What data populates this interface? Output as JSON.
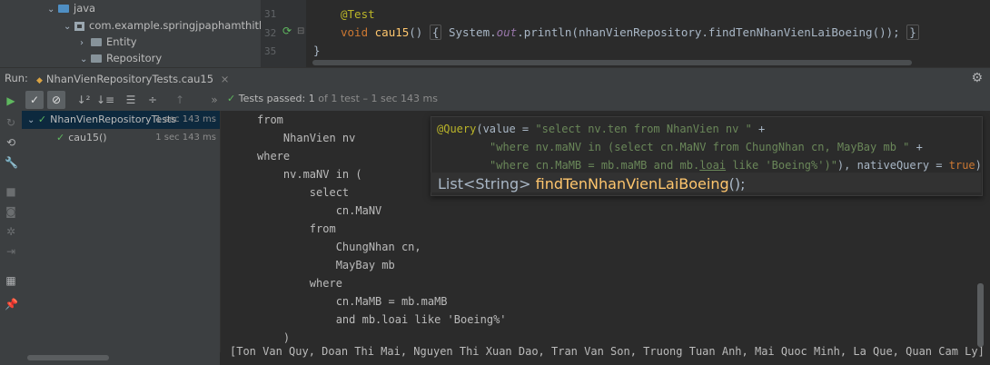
{
  "project_tree": {
    "items": [
      {
        "label": "java",
        "icon": "folder-blue-icon"
      },
      {
        "label": "com.example.springjpaphamthithanhn",
        "icon": "package-icon"
      },
      {
        "label": "Entity",
        "icon": "folder-icon"
      },
      {
        "label": "Repository",
        "icon": "folder-icon"
      }
    ]
  },
  "editor": {
    "line_numbers": [
      "31",
      "32",
      "35"
    ],
    "annotation": "@Test",
    "kw_void": "void",
    "method_name": "cau15",
    "parens": "()",
    "body_open": "{",
    "system": "System.",
    "out": "out",
    "println": ".println(",
    "repo_call": "nhanVienRepository",
    "find_method": ".findTenNhanVienLaiBoeing",
    "call_end": "());",
    "body_close": "}",
    "closing_brace": "}"
  },
  "run_bar": {
    "run_label": "Run:",
    "tab_label": "NhanVienRepositoryTests.cau15",
    "tab_close": "×"
  },
  "test_toolbar": {
    "tests_passed": "Tests passed:",
    "tests_count": "1",
    "tests_detail": "of 1 test – 1 sec 143 ms"
  },
  "test_tree": {
    "root": {
      "label": "NhanVienRepositoryTests",
      "time": "1 sec 143 ms"
    },
    "child": {
      "label": "cau15()",
      "time": "1 sec 143 ms"
    }
  },
  "console": {
    "lines": [
      "from",
      "    NhanVien nv",
      "where",
      "    nv.maNV in (",
      "        select",
      "            cn.MaNV",
      "        from",
      "            ChungNhan cn,",
      "            MayBay mb",
      "        where",
      "            cn.MaMB = mb.maMB",
      "            and mb.loai like 'Boeing%'",
      "    )"
    ],
    "output": "[Ton Van Quy, Doan Thi Mai, Nguyen Thi Xuan Dao, Tran Van Son, Truong Tuan Anh, Mai Quoc Minh, La Que, Quan Cam Ly]"
  },
  "popup": {
    "query_ann": "@Query",
    "value_kw": "(value = ",
    "str1": "\"select nv.ten from NhanVien nv \"",
    "plus": " +",
    "str2": "\"where nv.maNV in (select cn.MaNV from ChungNhan cn, MayBay mb \"",
    "str3": "\"where cn.MaMB = mb.maMB and mb.",
    "str3_loai": "loai",
    "str3_end": " like 'Boeing%')\"",
    "native": "), nativeQuery = ",
    "true_kw": "true",
    "close": ")",
    "sig_type": "List<String> ",
    "sig_name": "findTenNhanVienLaiBoeing",
    "sig_end": "();"
  },
  "colors": {
    "accent": "#4a88c7",
    "pass": "#5fb85f",
    "background": "#2b2b2b"
  }
}
